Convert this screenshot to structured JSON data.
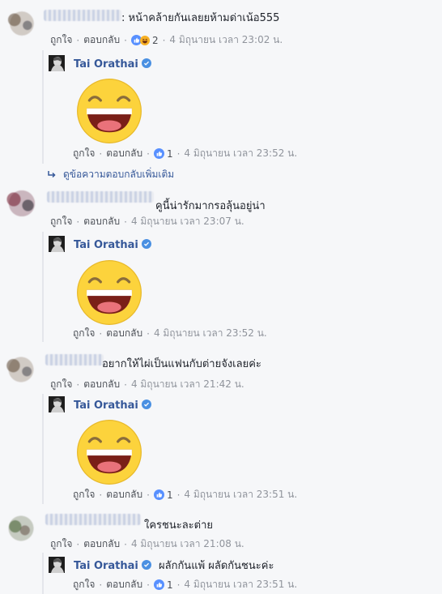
{
  "meta_actions": {
    "like": "ถูกใจ",
    "reply": "ตอบกลับ",
    "dot": "·"
  },
  "colors": {
    "link": "#365899",
    "meta": "#90949c",
    "like_blue": "#5890ff",
    "sticker_yellow": "#fcd33c"
  },
  "comments": [
    {
      "text": ": หน้าคล้ายกันเลยยห้ามด่าเน้อ555",
      "reaction_count": "2",
      "time": "4 มิถุนายน เวลา 23:02 น.",
      "reply": {
        "name": "Tai Orathai",
        "text": "",
        "reaction_count": "1",
        "time": "4 มิถุนายน เวลา 23:52 น."
      },
      "more_replies": "ดูข้อความตอบกลับเพิ่มเติม"
    },
    {
      "text": "คูนี้น่ารักมากรอลุ้นอยู่น่า",
      "time": "4 มิถุนายน เวลา 23:07 น.",
      "reply": {
        "name": "Tai Orathai",
        "text": "",
        "time": "4 มิถุนายน เวลา 23:52 น."
      }
    },
    {
      "text": "อยากให้ไผ่เป็นแฟนกับต่ายจังเลยค่ะ",
      "time": "4 มิถุนายน เวลา 21:42 น.",
      "reply": {
        "name": "Tai Orathai",
        "text": "",
        "reaction_count": "1",
        "time": "4 มิถุนายน เวลา 23:51 น."
      }
    },
    {
      "text": "ใครชนะละต่าย",
      "time": "4 มิถุนายน เวลา 21:08 น.",
      "reply": {
        "name": "Tai Orathai",
        "text": "ผลักกันแพ้ ผลัดกันชนะค่ะ",
        "reaction_count": "1",
        "time": "4 มิถุนายน เวลา 23:51 น."
      }
    }
  ]
}
